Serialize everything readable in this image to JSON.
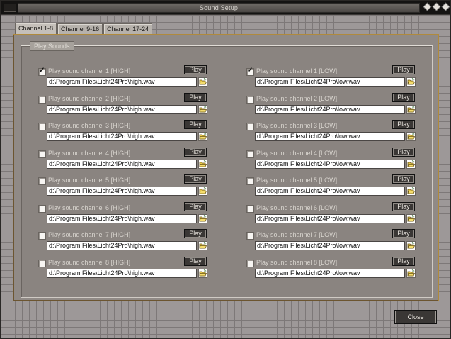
{
  "window": {
    "title": "Sound Setup"
  },
  "tabs": [
    "Channel 1-8",
    "Channel 9-16",
    "Channel 17-24"
  ],
  "active_tab": 0,
  "group": {
    "title": "Play Sounds"
  },
  "play_label": "Play",
  "close_label": "Close",
  "high_channels": [
    {
      "label": "Play sound channel 1 [HIGH]",
      "checked": true,
      "path": "d:\\Program Files\\Licht24Pro\\high.wav"
    },
    {
      "label": "Play sound channel 2 [HIGH]",
      "checked": false,
      "path": "d:\\Program Files\\Licht24Pro\\high.wav"
    },
    {
      "label": "Play sound channel 3 [HIGH]",
      "checked": false,
      "path": "d:\\Program Files\\Licht24Pro\\high.wav"
    },
    {
      "label": "Play sound channel 4 [HIGH]",
      "checked": false,
      "path": "d:\\Program Files\\Licht24Pro\\high.wav"
    },
    {
      "label": "Play sound channel 5 [HIGH]",
      "checked": false,
      "path": "d:\\Program Files\\Licht24Pro\\high.wav"
    },
    {
      "label": "Play sound channel 6 [HIGH]",
      "checked": false,
      "path": "d:\\Program Files\\Licht24Pro\\high.wav"
    },
    {
      "label": "Play sound channel 7 [HIGH]",
      "checked": false,
      "path": "d:\\Program Files\\Licht24Pro\\high.wav"
    },
    {
      "label": "Play sound channel 8 [HIGH]",
      "checked": false,
      "path": "d:\\Program Files\\Licht24Pro\\high.wav"
    }
  ],
  "low_channels": [
    {
      "label": "Play sound channel 1 [LOW]",
      "checked": true,
      "path": "d:\\Program Files\\Licht24Pro\\low.wav"
    },
    {
      "label": "Play sound channel 2 [LOW]",
      "checked": false,
      "path": "d:\\Program Files\\Licht24Pro\\low.wav"
    },
    {
      "label": "Play sound channel 3 [LOW]",
      "checked": false,
      "path": "d:\\Program Files\\Licht24Pro\\low.wav"
    },
    {
      "label": "Play sound channel 4 [LOW]",
      "checked": false,
      "path": "d:\\Program Files\\Licht24Pro\\low.wav"
    },
    {
      "label": "Play sound channel 5 [LOW]",
      "checked": false,
      "path": "d:\\Program Files\\Licht24Pro\\low.wav"
    },
    {
      "label": "Play sound channel 6 [LOW]",
      "checked": false,
      "path": "d:\\Program Files\\Licht24Pro\\low.wav"
    },
    {
      "label": "Play sound channel 7 [LOW]",
      "checked": false,
      "path": "d:\\Program Files\\Licht24Pro\\low.wav"
    },
    {
      "label": "Play sound channel 8 [LOW]",
      "checked": false,
      "path": "d:\\Program Files\\Licht24Pro\\low.wav"
    }
  ],
  "icons": {
    "folder": "folder-open-icon",
    "check": "checkmark-icon"
  },
  "colors": {
    "accent_border": "#b08a3c",
    "panel": "#908a86"
  }
}
